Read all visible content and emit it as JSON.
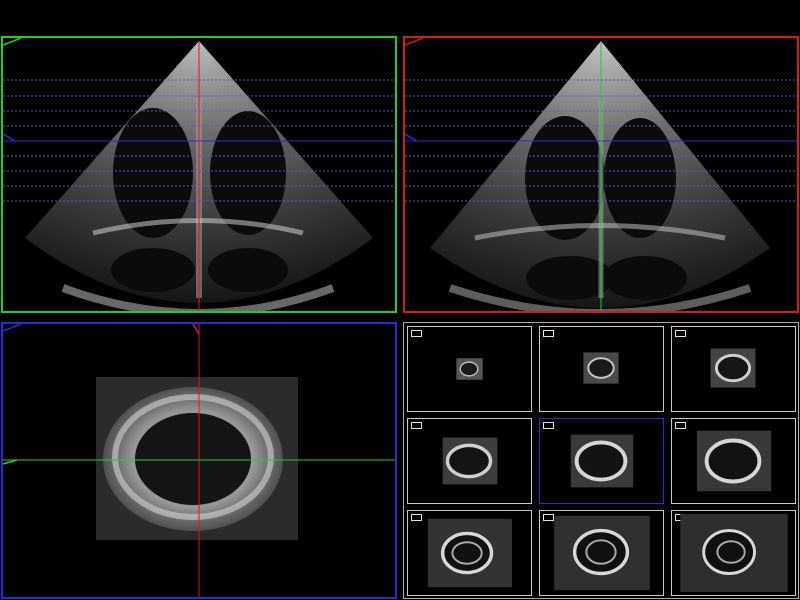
{
  "app": {
    "panes": [
      {
        "id": "apical-view-a",
        "border_color": "#1fd11f",
        "crosshair_color": "#d81c1c"
      },
      {
        "id": "apical-view-b",
        "border_color": "#d81c1c",
        "crosshair_color": "#1fd11f"
      },
      {
        "id": "short-axis-view",
        "border_color": "#2a2ad8",
        "crosshair_color": "#d81c1c"
      },
      {
        "id": "slice-grid",
        "border_color": "#a8a8a8",
        "slice_count": 9,
        "active_slice_index": 4,
        "active_border_color": "#2a2ad8"
      }
    ],
    "slice_line_color": "#5a5ad8",
    "active_slice_line_color": "#2a2ad8",
    "icons": [
      "orientation-marker-icon",
      "slice-thumbnail-marker-icon"
    ]
  }
}
